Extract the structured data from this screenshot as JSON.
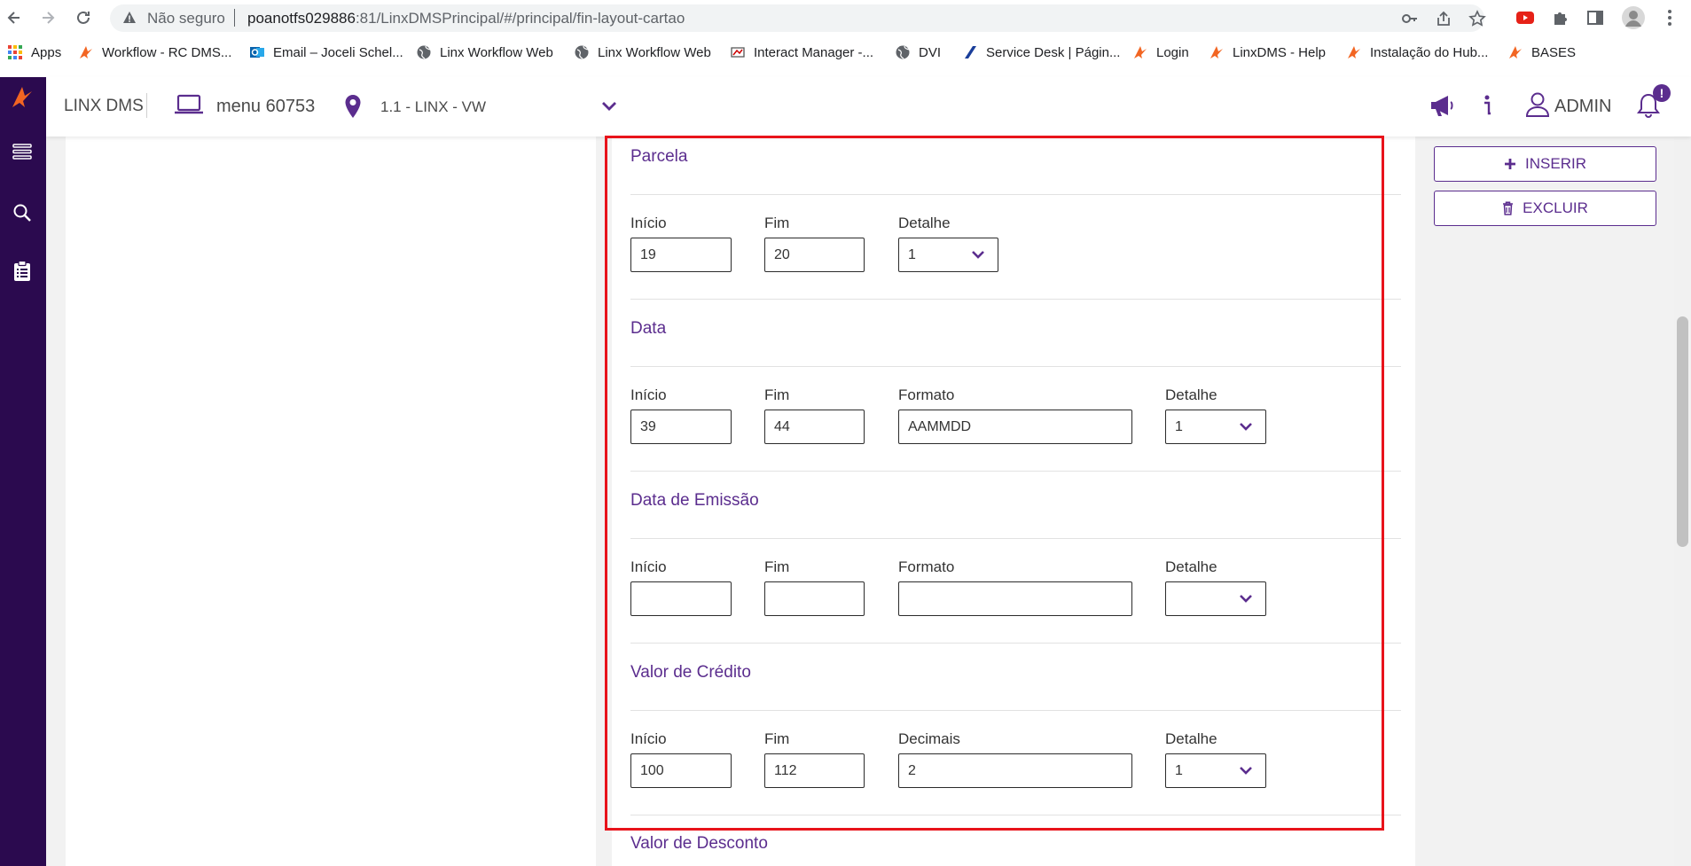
{
  "browser": {
    "not_secure": "Não seguro",
    "url_host": "poanotfs029886",
    "url_rest": ":81/LinxDMSPrincipal/#/principal/fin-layout-cartao"
  },
  "bookmarks": [
    {
      "label": "Apps",
      "icon": "apps-grid-icon"
    },
    {
      "label": "Workflow - RC DMS...",
      "icon": "linx-logo-icon"
    },
    {
      "label": "Email – Joceli Schel...",
      "icon": "outlook-icon"
    },
    {
      "label": "Linx Workflow Web",
      "icon": "globe-icon"
    },
    {
      "label": "Linx Workflow Web",
      "icon": "globe-icon"
    },
    {
      "label": "Interact Manager -...",
      "icon": "interact-icon"
    },
    {
      "label": "DVI",
      "icon": "globe-icon"
    },
    {
      "label": "Service Desk | Págin...",
      "icon": "service-desk-icon"
    },
    {
      "label": "Login",
      "icon": "linx-logo-icon"
    },
    {
      "label": "LinxDMS - Help",
      "icon": "linx-logo-icon"
    },
    {
      "label": "Instalação do Hub...",
      "icon": "linx-logo-icon"
    },
    {
      "label": "BASES",
      "icon": "linx-logo-icon"
    }
  ],
  "header": {
    "brand": "LINX DMS",
    "menu": "menu 60753",
    "location": "1.1 - LINX - VW",
    "user": "ADMIN",
    "notification_badge": "!"
  },
  "actions": {
    "insert": "INSERIR",
    "delete": "EXCLUIR"
  },
  "sections": {
    "parcela": {
      "title": "Parcela",
      "inicio_label": "Início",
      "inicio": "19",
      "fim_label": "Fim",
      "fim": "20",
      "detalhe_label": "Detalhe",
      "detalhe": "1"
    },
    "data": {
      "title": "Data",
      "inicio_label": "Início",
      "inicio": "39",
      "fim_label": "Fim",
      "fim": "44",
      "formato_label": "Formato",
      "formato": "AAMMDD",
      "detalhe_label": "Detalhe",
      "detalhe": "1"
    },
    "data_emissao": {
      "title": "Data de Emissão",
      "inicio_label": "Início",
      "inicio": "",
      "fim_label": "Fim",
      "fim": "",
      "formato_label": "Formato",
      "formato": "",
      "detalhe_label": "Detalhe",
      "detalhe": ""
    },
    "valor_credito": {
      "title": "Valor de Crédito",
      "inicio_label": "Início",
      "inicio": "100",
      "fim_label": "Fim",
      "fim": "112",
      "decimais_label": "Decimais",
      "decimais": "2",
      "detalhe_label": "Detalhe",
      "detalhe": "1"
    },
    "valor_desconto": {
      "title": "Valor de Desconto"
    }
  },
  "colors": {
    "brand_purple": "#5b2d8e",
    "sidebar": "#2b0a4f",
    "highlight": "#e8131b"
  }
}
